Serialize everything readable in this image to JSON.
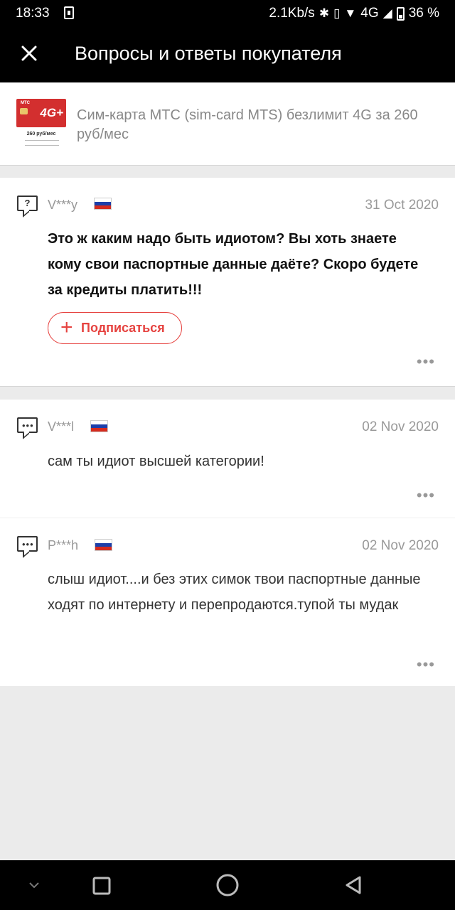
{
  "status_bar": {
    "time": "18:33",
    "network_speed": "2.1Kb/s",
    "network_type": "4G",
    "battery": "36 %"
  },
  "app_bar": {
    "title": "Вопросы и ответы покупателя"
  },
  "product": {
    "title": "Сим-карта МТС (sim-card MTS) безлимит 4G за 260 руб/мес",
    "thumb_brand": "МТС",
    "thumb_badge": "4G+",
    "thumb_price": "260 руб/мес"
  },
  "question": {
    "user": "V***y",
    "date": "31 Oct 2020",
    "text": "Это ж каким надо быть идиотом? Вы хоть знаете кому свои паспортные данные даёте? Скоро будете за кредиты платить!!!",
    "subscribe_label": "Подписаться"
  },
  "answers": [
    {
      "user": "V***l",
      "date": "02 Nov 2020",
      "text": "сам ты идиот высшей категории!"
    },
    {
      "user": "P***h",
      "date": "02 Nov 2020",
      "text": "слыш идиот....и без этих симок твои паспортные данные ходят по интернету и перепродаются.тупой ты мудак"
    }
  ],
  "colors": {
    "accent": "#e64340",
    "header_bg": "#000000",
    "muted_text": "#999999"
  }
}
